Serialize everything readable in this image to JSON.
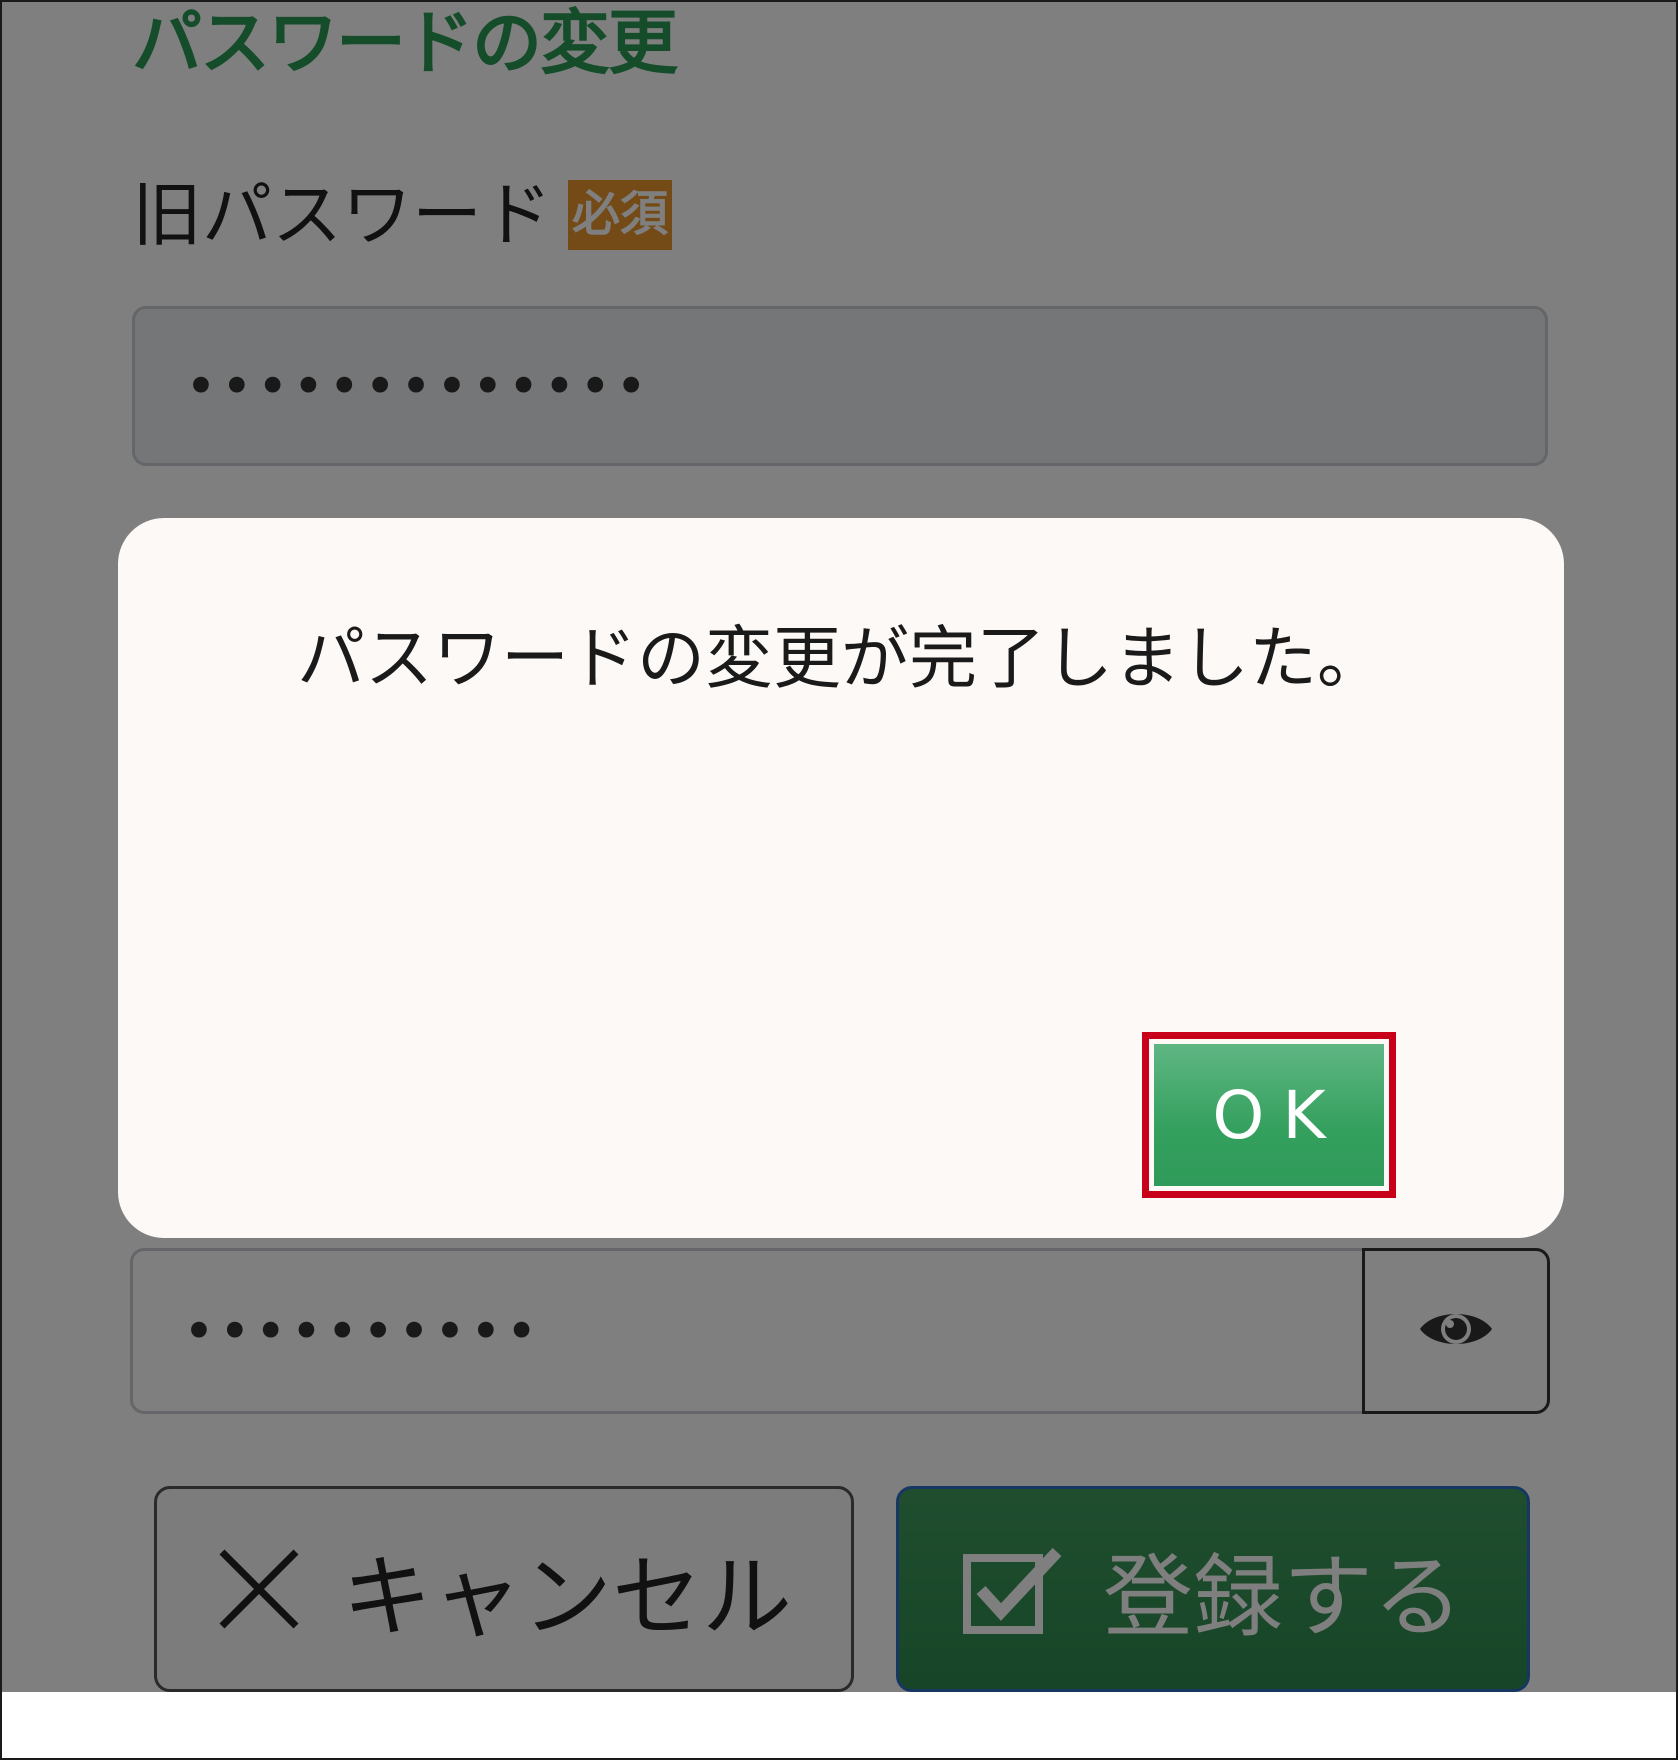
{
  "page": {
    "title": "パスワードの変更",
    "old_password": {
      "label": "旧パスワード",
      "required_badge": "必須",
      "masked_value": "•••••••••••••"
    },
    "new_password": {
      "masked_value": "••••••••••",
      "toggle_icon": "eye-icon"
    },
    "cancel_button": {
      "label": "キャンセル",
      "icon": "close-icon"
    },
    "submit_button": {
      "label": "登録する",
      "icon": "checkbox-icon"
    }
  },
  "dialog": {
    "message": "パスワードの変更が完了しました。",
    "ok_label": "OK"
  },
  "colors": {
    "title_green": "#2a9a55",
    "badge_orange": "#e8952c",
    "ok_green": "#34a05e",
    "highlight_red": "#c8001a",
    "submit_border_blue": "#2e6fc4"
  }
}
